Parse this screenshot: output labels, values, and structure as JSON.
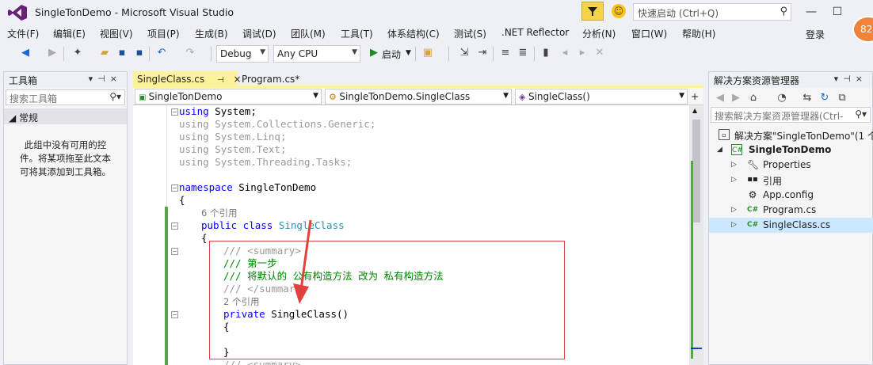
{
  "window": {
    "title": "SingleTonDemo - Microsoft Visual Studio",
    "quick_launch_placeholder": "快速启动 (Ctrl+Q)",
    "login": "登录",
    "notification_count": "82"
  },
  "menu": [
    "文件(F)",
    "编辑(E)",
    "视图(V)",
    "项目(P)",
    "生成(B)",
    "调试(D)",
    "团队(M)",
    "工具(T)",
    "体系结构(C)",
    "测试(S)",
    ".NET Reflector",
    "分析(N)",
    "窗口(W)",
    "帮助(H)"
  ],
  "toolbar": {
    "config": "Debug",
    "platform": "Any CPU",
    "start": "启动"
  },
  "toolbox": {
    "title": "工具箱",
    "search_placeholder": "搜索工具箱",
    "group": "常规",
    "empty_line1": "此组中没有可用的控",
    "empty_line2": "件。将某项拖至此文本",
    "empty_line3": "可将其添加到工具箱。"
  },
  "tabs": [
    {
      "label": "SingleClass.cs",
      "pin": "⊣",
      "close": "×"
    },
    {
      "label": "Program.cs*"
    }
  ],
  "nav": {
    "project": "SingleTonDemo",
    "type": "SingleTonDemo.SingleClass",
    "member": "SingleClass()"
  },
  "code": {
    "l1_kw": "using",
    "l1_ns": " System;",
    "l2_kw": "using",
    "l2_ns": " System.Collections.Generic;",
    "l3_kw": "using",
    "l3_ns": " System.Linq;",
    "l4_kw": "using",
    "l4_ns": " System.Text;",
    "l5_kw": "using",
    "l5_ns": " System.Threading.Tasks;",
    "ns_kw": "namespace",
    "ns_name": " SingleTonDemo",
    "brace_open": "{",
    "ref6": "6 个引用",
    "cls_kw1": "public",
    "cls_kw2": " class",
    "cls_name": " SingleClass",
    "brace_open2": "{",
    "sum_open_slash": "/// ",
    "sum_open_tag": "<summary>",
    "c_step": "/// 第一步",
    "c_desc": "/// 将默认的 公有构造方法 改为 私有构造方法",
    "sum_close_slash": "/// ",
    "sum_close_tag": "</summary>",
    "ref2": "2 个引用",
    "ctor_kw": "private",
    "ctor_name": " SingleClass()",
    "brace_open3": "{",
    "brace_close3": "}",
    "sum_next_slash": "/// ",
    "sum_next_tag": "<summary>"
  },
  "solution_explorer": {
    "title": "解决方案资源管理器",
    "search_placeholder": "搜索解决方案资源管理器(Ctrl-",
    "items": [
      {
        "label": "解决方案\"SingleTonDemo\"(1 个"
      },
      {
        "label": "SingleTonDemo"
      },
      {
        "label": "Properties"
      },
      {
        "label": "引用"
      },
      {
        "label": "App.config"
      },
      {
        "label": "Program.cs"
      },
      {
        "label": "SingleClass.cs"
      }
    ]
  },
  "colors": {
    "accent_tab": "#fff29d",
    "annotation": "#e0413a",
    "keyword": "#0000ff",
    "type": "#2b91af",
    "comment": "#008000"
  }
}
